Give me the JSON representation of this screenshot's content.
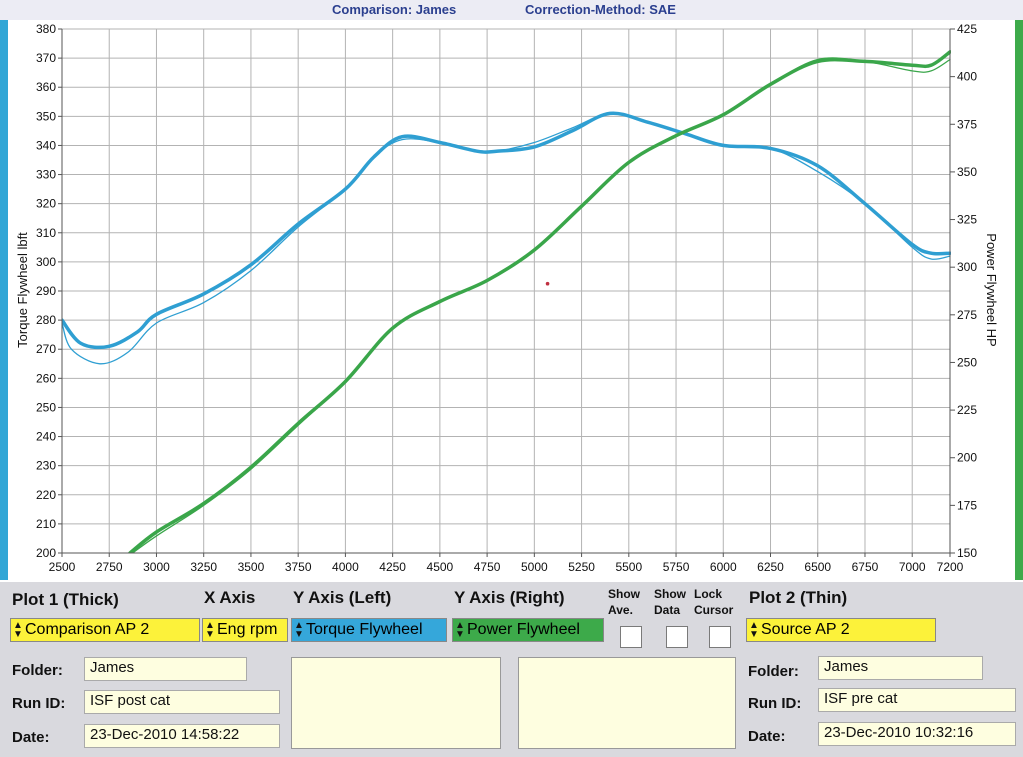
{
  "header": {
    "comparison": "Comparison: James",
    "correction": "Correction-Method: SAE"
  },
  "colors": {
    "torque": "#2f9fd2",
    "power": "#3aa64a",
    "grid": "#b3b3b3",
    "axis": "#555555",
    "yellow": "#fcf23a"
  },
  "chart_data": {
    "type": "line",
    "xlabel": "",
    "ylabel": "Torque Flywheel lbft",
    "y2label": "Power Flywheel HP",
    "xlim": [
      2500,
      7200
    ],
    "ylim": [
      200,
      380
    ],
    "y2lim": [
      150,
      425
    ],
    "xticks": [
      2500,
      2750,
      3000,
      3250,
      3500,
      3750,
      4000,
      4250,
      4500,
      4750,
      5000,
      5250,
      5500,
      5750,
      6000,
      6250,
      6500,
      6750,
      7000,
      7200
    ],
    "yticks": [
      200,
      210,
      220,
      230,
      240,
      250,
      260,
      270,
      280,
      290,
      300,
      310,
      320,
      330,
      340,
      350,
      360,
      370,
      380
    ],
    "y2ticks": [
      150,
      175,
      200,
      225,
      250,
      275,
      300,
      325,
      350,
      375,
      400,
      425
    ],
    "grid": true,
    "series": [
      {
        "name": "Torque Flywheel",
        "plot": "Plot 1 (Thick)",
        "axis": "left",
        "color": "#2f9fd2",
        "x": [
          2500,
          2600,
          2750,
          2900,
          3000,
          3250,
          3500,
          3750,
          4000,
          4150,
          4300,
          4500,
          4700,
          4800,
          5000,
          5200,
          5400,
          5600,
          5800,
          6000,
          6250,
          6500,
          6750,
          7000,
          7100,
          7200
        ],
        "y": [
          280,
          272,
          271,
          276,
          282,
          289,
          299,
          313,
          325,
          336,
          343,
          341,
          338,
          338,
          339.5,
          345,
          351,
          348,
          344,
          340,
          339,
          333,
          320,
          306,
          303,
          303
        ]
      },
      {
        "name": "Torque Flywheel",
        "plot": "Plot 2 (Thin)",
        "axis": "left",
        "color": "#2f9fd2",
        "x": [
          2500,
          2550,
          2700,
          2850,
          3000,
          3250,
          3500,
          3750,
          4000,
          4150,
          4300,
          4500,
          4700,
          4800,
          5000,
          5200,
          5400,
          5600,
          5800,
          6000,
          6250,
          6500,
          6750,
          7000,
          7100,
          7200
        ],
        "y": [
          279,
          270,
          265,
          269,
          279,
          286,
          297,
          312,
          325,
          336,
          342,
          341,
          338,
          338,
          341,
          346,
          351,
          348,
          344,
          340,
          339,
          331,
          320,
          305,
          301,
          302
        ]
      },
      {
        "name": "Power Flywheel",
        "plot": "Plot 1 (Thick)",
        "axis": "right",
        "color": "#3aa64a",
        "x": [
          2860,
          3000,
          3250,
          3500,
          3750,
          4000,
          4250,
          4500,
          4750,
          5000,
          5250,
          5500,
          5750,
          6000,
          6250,
          6500,
          6750,
          7000,
          7100,
          7200
        ],
        "y": [
          150,
          161,
          176,
          195,
          218,
          240,
          268,
          282,
          293,
          309,
          332,
          355,
          369,
          380,
          396,
          408,
          408,
          406,
          406,
          413
        ]
      },
      {
        "name": "Power Flywheel",
        "plot": "Plot 2 (Thin)",
        "axis": "right",
        "color": "#3aa64a",
        "x": [
          2860,
          3000,
          3250,
          3500,
          3750,
          4000,
          4250,
          4500,
          4750,
          5000,
          5250,
          5500,
          5750,
          6000,
          6250,
          6500,
          6750,
          7000,
          7100,
          7200
        ],
        "y": [
          149,
          159,
          175,
          194,
          217,
          240,
          268,
          282,
          293,
          309,
          332,
          355,
          369,
          380,
          396,
          409,
          408,
          403,
          403,
          409
        ]
      }
    ]
  },
  "panel": {
    "plot1_title": "Plot 1 (Thick)",
    "xaxis_title": "X Axis",
    "yleft_title": "Y Axis (Left)",
    "yright_title": "Y Axis (Right)",
    "show_ave_1": "Show",
    "show_ave_2": "Ave.",
    "show_data_1": "Show",
    "show_data_2": "Data",
    "lock_cursor_1": "Lock",
    "lock_cursor_2": "Cursor",
    "plot2_title": "Plot 2 (Thin)",
    "plot1_select": "Comparison AP 2",
    "xaxis_select": "Eng rpm",
    "yleft_select": "Torque Flywheel",
    "yright_select": "Power Flywheel",
    "plot2_select": "Source AP 2",
    "folder_label": "Folder:",
    "runid_label": "Run ID:",
    "date_label": "Date:",
    "plot1_folder": "James",
    "plot1_runid": "ISF post cat",
    "plot1_date": "23-Dec-2010  14:58:22",
    "plot2_folder": "James",
    "plot2_runid": "ISF pre cat",
    "plot2_date": "23-Dec-2010  10:32:16"
  }
}
